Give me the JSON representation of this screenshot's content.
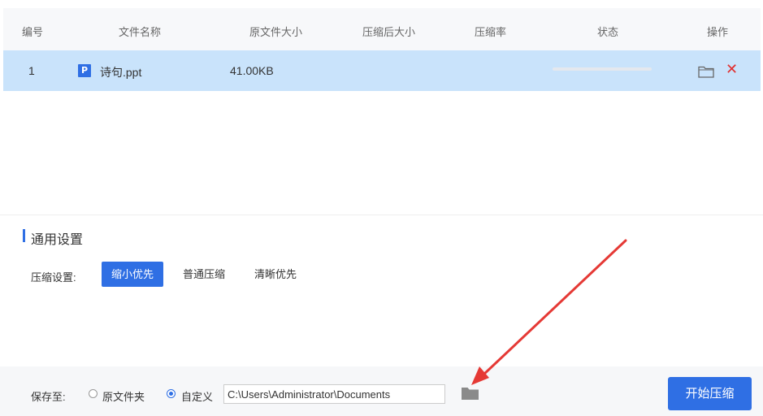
{
  "table": {
    "headers": {
      "index": "编号",
      "file_name": "文件名称",
      "original_size": "原文件大小",
      "compressed_size": "压缩后大小",
      "ratio": "压缩率",
      "status": "状态",
      "actions": "操作"
    },
    "rows": [
      {
        "index": "1",
        "type_icon": "ppt-file-icon",
        "type_letter": "P",
        "file_name": "诗句.ppt",
        "original_size": "41.00KB",
        "compressed_size": "",
        "ratio": "",
        "progress": 0,
        "actions": {
          "open": "folder-icon",
          "delete": "close-icon"
        }
      }
    ]
  },
  "settings": {
    "title": "通用设置",
    "compress_label": "压缩设置:",
    "options": [
      {
        "label": "缩小优先",
        "selected": true
      },
      {
        "label": "普通压缩",
        "selected": false
      },
      {
        "label": "清晰优先",
        "selected": false
      }
    ]
  },
  "footer": {
    "save_label": "保存至:",
    "radio_options": [
      {
        "label": "原文件夹",
        "selected": false
      },
      {
        "label": "自定义",
        "selected": true
      }
    ],
    "path_value": "C:\\Users\\Administrator\\Documents",
    "browse_icon": "folder-icon",
    "start_button": "开始压缩"
  },
  "colors": {
    "accent": "#2f6fe4",
    "row_selected": "#c9e3fb",
    "delete": "#e03030",
    "annotation_arrow": "#e53935"
  }
}
